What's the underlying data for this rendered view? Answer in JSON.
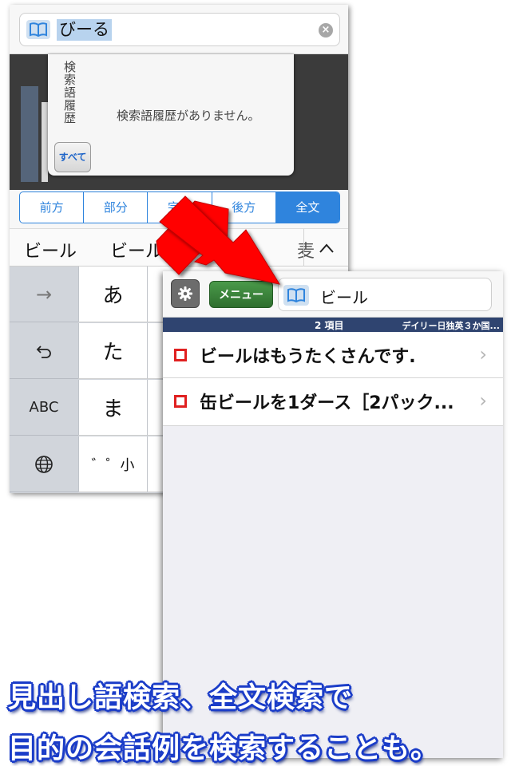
{
  "left_screen": {
    "search": {
      "query": "びーる"
    },
    "history": {
      "title": "検索語履歴",
      "empty_message": "検索語履歴がありません。",
      "all_button": "すべて"
    },
    "search_modes": {
      "items": [
        "前方",
        "部分",
        "完全",
        "後方",
        "全文"
      ],
      "selected": "全文"
    },
    "candidates": [
      "ビール",
      "ビール",
      "麦"
    ],
    "candidate_collapse": "^",
    "keyboard": {
      "side_keys": [
        "→",
        "↺",
        "ABC",
        "🌐"
      ],
      "kana_keys": [
        "あ",
        "た",
        "ま",
        "゛゜小"
      ]
    }
  },
  "right_screen": {
    "menu_button": "メニュー",
    "search_query": "ビール",
    "result_count": "2 項目",
    "dictionary_name": "デイリー日独英３か国...",
    "results": [
      "ビールはもうたくさんです.",
      "缶ビールを1ダース［2パック..."
    ]
  },
  "caption": {
    "line1": "見出し語検索、全文検索で",
    "line2": "目的の会話例を検索することも。"
  },
  "colors": {
    "accent_blue": "#2f84dd",
    "arrow_red": "#ff0000",
    "result_header": "#2f4470",
    "caption_outline": "#1a3cc8"
  }
}
